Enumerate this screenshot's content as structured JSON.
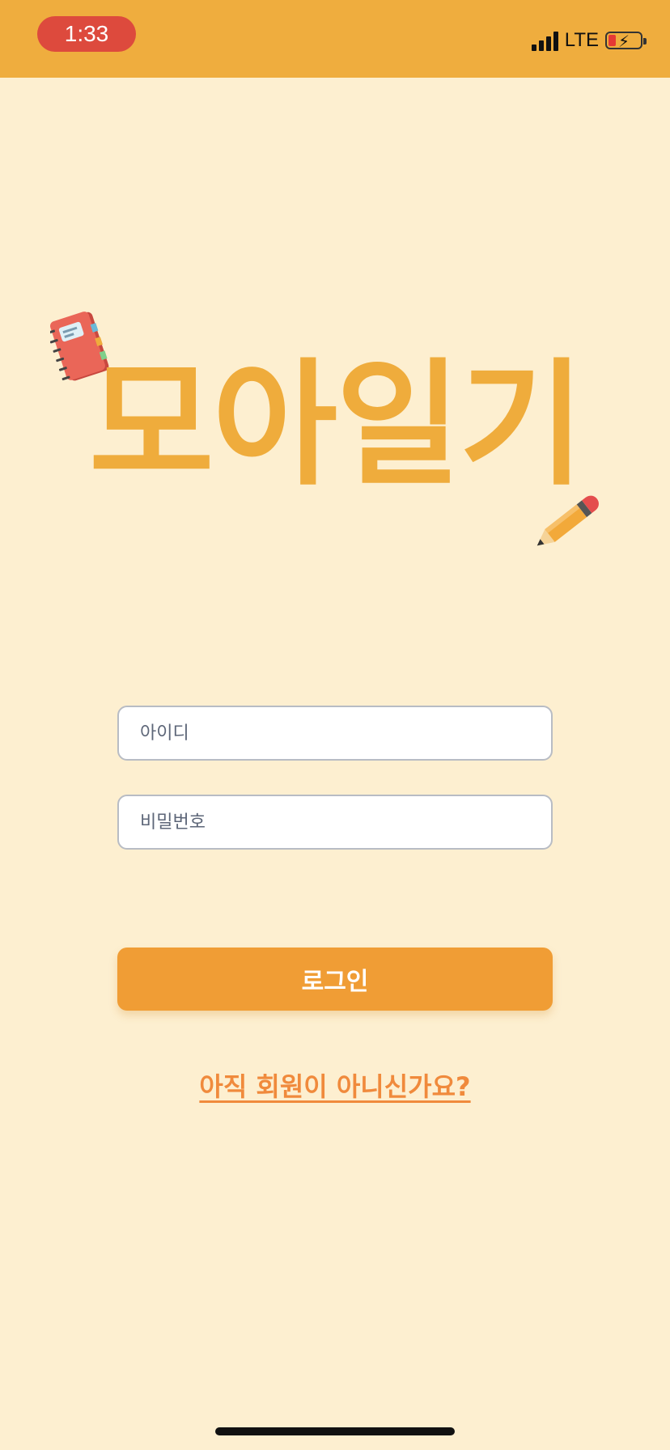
{
  "status_bar": {
    "time": "1:33",
    "network": "LTE",
    "signal_icon": "signal-bars-icon",
    "battery_icon": "battery-charging-icon",
    "battery_color": "#e53935"
  },
  "app": {
    "logo_text": "모아일기",
    "logo_color": "#efac3c",
    "notebook_icon": "notebook-icon",
    "pencil_icon": "pencil-icon"
  },
  "form": {
    "id_placeholder": "아이디",
    "password_placeholder": "비밀번호",
    "login_label": "로그인",
    "signup_link": "아직 회원이 아니신가요?"
  },
  "colors": {
    "background": "#fdefd0",
    "status_bar": "#efad3e",
    "time_pill": "#dd4a3d",
    "button": "#f09d35",
    "link": "#f08a3c"
  }
}
